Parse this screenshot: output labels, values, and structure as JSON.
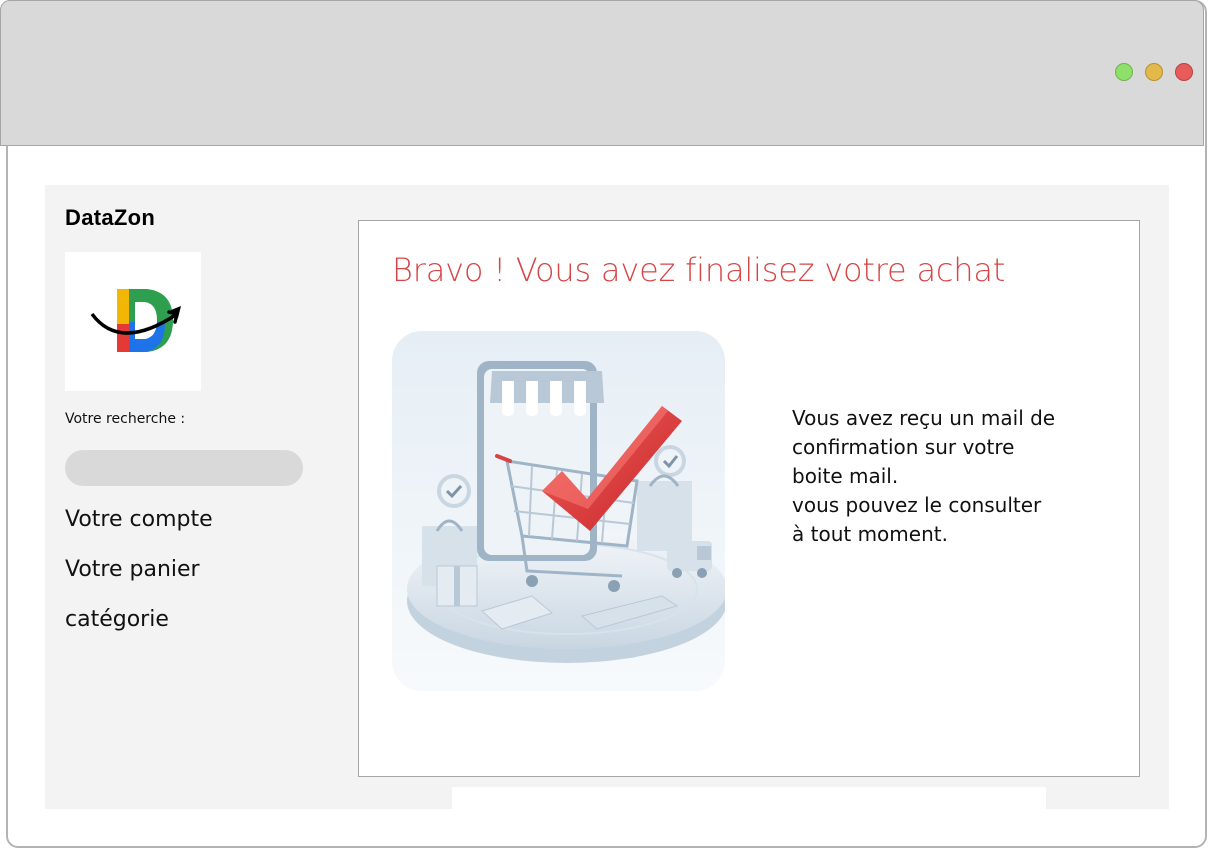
{
  "window": {
    "controls": [
      "green",
      "yellow",
      "red"
    ],
    "colors": {
      "green": "#8fe06a",
      "yellow": "#e3b94b",
      "red": "#e75b5b"
    }
  },
  "sidebar": {
    "brand": "DataZon",
    "logo_icon": "datazon-logo-icon",
    "search_label": "Votre recherche :",
    "search_value": "",
    "nav": [
      {
        "label": "Votre compte"
      },
      {
        "label": "Votre panier"
      },
      {
        "label": "catégorie"
      }
    ]
  },
  "main": {
    "title": "Bravo ! Vous avez finalisez votre achat",
    "title_color": "#d64545",
    "illustration_icon": "shopping-cart-checkmark-illustration",
    "message_lines": [
      "Vous avez reçu un mail de",
      "confirmation sur votre",
      "boite mail.",
      "vous pouvez le consulter",
      "à tout moment."
    ]
  }
}
